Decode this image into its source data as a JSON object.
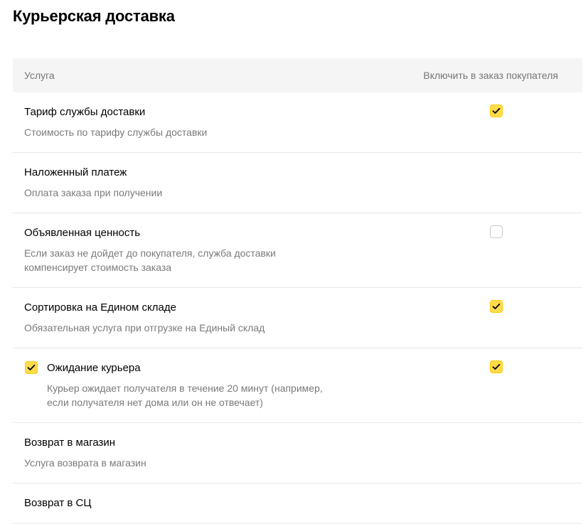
{
  "page": {
    "title": "Курьерская доставка"
  },
  "table": {
    "header": {
      "service": "Услуга",
      "include": "Включить в заказ покупателя"
    },
    "rows": [
      {
        "name": "Тариф службы доставки",
        "description": "Стоимость по тарифу службы доставки",
        "include_checkbox": "checked"
      },
      {
        "name": "Наложенный платеж",
        "description": "Оплата заказа при получении",
        "include_checkbox": "none"
      },
      {
        "name": "Объявленная ценность",
        "description_lines": [
          "Если заказ не дойдет до покупателя, служба доставки",
          "компенсирует стоимость заказа"
        ],
        "include_checkbox": "unchecked"
      },
      {
        "name": "Сортировка на Едином складе",
        "description": "Обязательная услуга при отгрузке на Единый склад",
        "include_checkbox": "checked"
      },
      {
        "name": "Ожидание курьера",
        "description_lines": [
          "Курьер ожидает получателя в течение 20 минут (например,",
          "если получателя нет дома или он не отвечает)"
        ],
        "service_checkbox": "checked",
        "include_checkbox": "checked"
      },
      {
        "name": "Возврат в магазин",
        "description": "Услуга возврата в магазин",
        "include_checkbox": "none"
      },
      {
        "name": "Возврат в СЦ",
        "description": "",
        "include_checkbox": "none"
      }
    ]
  },
  "colors": {
    "checkbox_checked_fill": "#ffdb4d",
    "checkbox_unchecked_border": "#c8c8c8",
    "header_background": "#f5f5f5",
    "muted_text": "#7a7a7a"
  },
  "icons": {
    "checkmark": "checkmark-icon"
  }
}
